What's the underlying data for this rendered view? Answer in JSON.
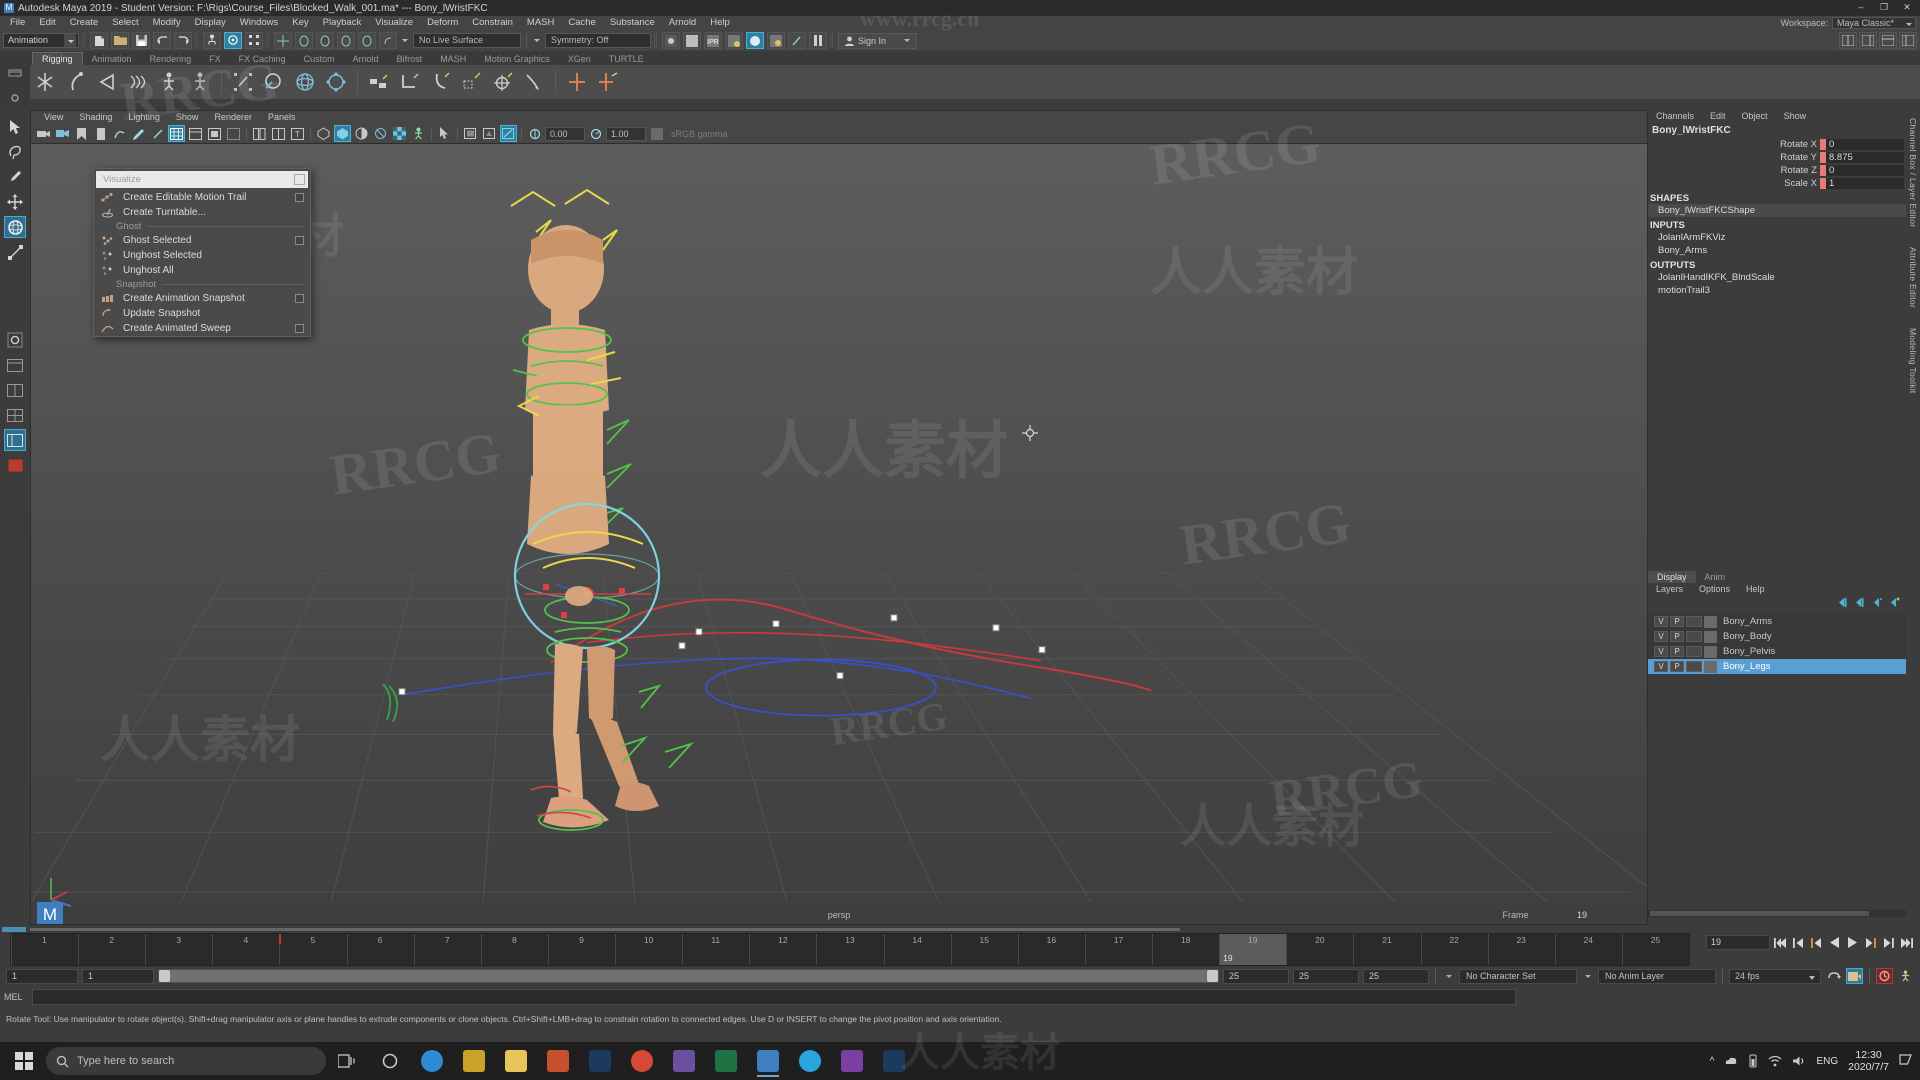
{
  "titlebar": {
    "text": "Autodesk Maya 2019 - Student Version: F:\\Rigs\\Course_Files\\Blocked_Walk_001.ma*   ---   Bony_lWristFKC",
    "logo": "M",
    "minimize": "–",
    "maximize": "❐",
    "close": "✕"
  },
  "menubar": {
    "items": [
      "File",
      "Edit",
      "Create",
      "Select",
      "Modify",
      "Display",
      "Windows",
      "Key",
      "Playback",
      "Visualize",
      "Deform",
      "Constrain",
      "MASH",
      "Cache",
      "Substance",
      "Arnold",
      "Help"
    ],
    "workspace_label": "Workspace:",
    "workspace_value": "Maya Classic*"
  },
  "statusline": {
    "mode": "Animation",
    "live_surface": "No Live Surface",
    "symmetry": "Symmetry: Off",
    "signin": "Sign In"
  },
  "shelf": {
    "tabs": [
      "Rigging",
      "Animation",
      "Rendering",
      "FX",
      "FX Caching",
      "Custom",
      "Arnold",
      "Bifrost",
      "MASH",
      "Motion Graphics",
      "XGen",
      "TURTLE"
    ],
    "active_tab": "Rigging"
  },
  "viewport": {
    "menus": [
      "View",
      "Shading",
      "Lighting",
      "Show",
      "Renderer",
      "Panels"
    ],
    "exposure": "0.00",
    "gamma": "1.00",
    "gamma_label": "sRGB gamma",
    "camera_label": "persp",
    "frame_label": "Frame",
    "frame_value": "19"
  },
  "popmenu": {
    "title": "Visualize",
    "items": [
      {
        "type": "item",
        "label": "Create Editable Motion Trail",
        "icon": "motion-trail-icon",
        "option": true
      },
      {
        "type": "item",
        "label": "Create Turntable...",
        "icon": "turntable-icon",
        "option": false
      },
      {
        "type": "section",
        "label": "Ghost"
      },
      {
        "type": "item",
        "label": "Ghost Selected",
        "icon": "ghost-selected-icon",
        "option": true
      },
      {
        "type": "item",
        "label": "Unghost Selected",
        "icon": "unghost-selected-icon",
        "option": false
      },
      {
        "type": "item",
        "label": "Unghost All",
        "icon": "unghost-all-icon",
        "option": false
      },
      {
        "type": "section",
        "label": "Snapshot"
      },
      {
        "type": "item",
        "label": "Create Animation Snapshot",
        "icon": "animation-snapshot-icon",
        "option": true
      },
      {
        "type": "item",
        "label": "Update Snapshot",
        "icon": "update-snapshot-icon",
        "option": false
      },
      {
        "type": "item",
        "label": "Create Animated Sweep",
        "icon": "animated-sweep-icon",
        "option": true
      }
    ]
  },
  "channelbox": {
    "menus": [
      "Channels",
      "Edit",
      "Object",
      "Show"
    ],
    "object_name": "Bony_lWristFKC",
    "attributes": [
      {
        "name": "Rotate X",
        "value": "0"
      },
      {
        "name": "Rotate Y",
        "value": "8.875"
      },
      {
        "name": "Rotate Z",
        "value": "0"
      },
      {
        "name": "Scale X",
        "value": "1"
      }
    ],
    "sections": [
      {
        "title": "SHAPES",
        "nodes": [
          "Bony_lWristFKCShape"
        ],
        "highlight": 0
      },
      {
        "title": "INPUTS",
        "nodes": [
          "JolanlArmFKViz",
          "Bony_Arms"
        ],
        "highlight": -1
      },
      {
        "title": "OUTPUTS",
        "nodes": [
          "JolanlHandIKFK_BlndScale",
          "motionTrail3"
        ],
        "highlight": -1
      }
    ]
  },
  "layers": {
    "tabs": [
      "Display",
      "Anim"
    ],
    "active_tab": "Display",
    "menus": [
      "Layers",
      "Options",
      "Help"
    ],
    "rows": [
      {
        "v": "V",
        "p": "P",
        "name": "Bony_Arms",
        "selected": false
      },
      {
        "v": "V",
        "p": "P",
        "name": "Bony_Body",
        "selected": false
      },
      {
        "v": "V",
        "p": "P",
        "name": "Bony_Pelvis",
        "selected": false
      },
      {
        "v": "V",
        "p": "P",
        "name": "Bony_Legs",
        "selected": true
      }
    ]
  },
  "dock_right": {
    "labels": [
      "Channel Box / Layer Editor",
      "Attribute Editor",
      "Modeling Toolkit"
    ]
  },
  "timeline": {
    "ticks": [
      "1",
      "2",
      "3",
      "4",
      "5",
      "6",
      "7",
      "8",
      "9",
      "10",
      "11",
      "12",
      "13",
      "14",
      "15",
      "16",
      "17",
      "18",
      "19",
      "20",
      "21",
      "22",
      "23",
      "24",
      "25"
    ],
    "current_frame": "19",
    "playback_buttons": [
      "go-to-start",
      "step-back-key",
      "step-back-frame",
      "play-backwards",
      "play-forwards",
      "step-forward-frame",
      "step-forward-key",
      "go-to-end"
    ]
  },
  "rangeslider": {
    "anim_start": "1",
    "range_start": "1",
    "range_end": "25",
    "anim_end": "25",
    "playback_end": "25",
    "character_set": "No Character Set",
    "anim_layer": "No Anim Layer",
    "fps": "24 fps"
  },
  "commandline": {
    "mel_label": "MEL",
    "value": ""
  },
  "helpline": {
    "text": "Rotate Tool: Use manipulator to rotate object(s). Shift+drag manipulator axis or plane handles to extrude components or clone objects. Ctrl+Shift+LMB+drag to constrain rotation to connected edges. Use D or INSERT to change the pivot position and axis orientation."
  },
  "taskbar": {
    "search_placeholder": "Type here to search",
    "apps": [
      {
        "name": "edge-icon",
        "color": "#2e8ad6"
      },
      {
        "name": "store-icon",
        "color": "#c9a227"
      },
      {
        "name": "files-icon",
        "color": "#e8c55a"
      },
      {
        "name": "powerpoint-icon",
        "color": "#c4512b"
      },
      {
        "name": "photoshop-icon",
        "color": "#1b3a5c"
      },
      {
        "name": "chrome-icon",
        "color": "#d64937"
      },
      {
        "name": "premiere-icon",
        "color": "#6b4fa0"
      },
      {
        "name": "excel-icon",
        "color": "#1f7244"
      },
      {
        "name": "maya-icon",
        "color": "#3f7fbf"
      },
      {
        "name": "skype-icon",
        "color": "#2aa5dd"
      },
      {
        "name": "video-icon",
        "color": "#7a3fa0"
      },
      {
        "name": "photoshop2-icon",
        "color": "#1b3a5c"
      }
    ],
    "lang": "ENG",
    "time": "12:30",
    "date": "2020/7/7"
  },
  "watermarks": {
    "top": "www.rrcg.cn",
    "brand": "RRCG",
    "cn": "人人素材"
  },
  "colors": {
    "accent": "#3f7fbf",
    "selection": "#5a9fd4",
    "lock_red": "#e87a7a",
    "panel_bg": "#3c3c3c",
    "toolbar_bg": "#4d4d4d"
  }
}
